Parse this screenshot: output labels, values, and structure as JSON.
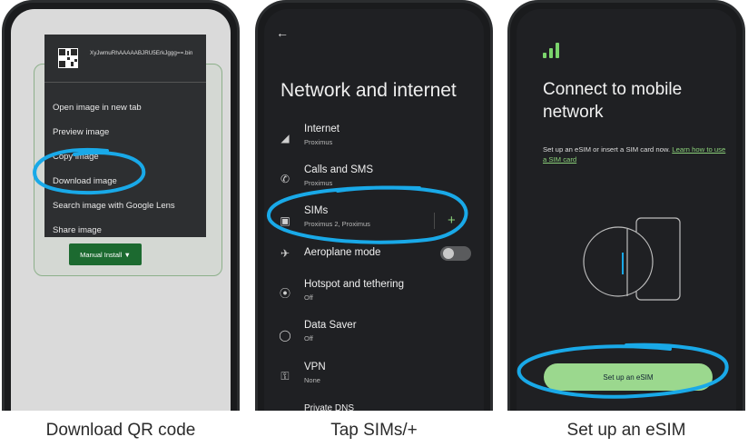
{
  "panels": [
    {
      "caption": "Download QR code",
      "file_name": "XyJwmuRhAAAAABJRU5ErkJggg==.bin",
      "menu_items": [
        "Open image in new tab",
        "Preview image",
        "Copy image",
        "Download image",
        "Search image with Google Lens",
        "Share image"
      ],
      "install_button": "Manual Install ▼"
    },
    {
      "caption": "Tap SIMs/+",
      "title": "Network and internet",
      "rows": [
        {
          "title": "Internet",
          "subtitle": "Proximus"
        },
        {
          "title": "Calls and SMS",
          "subtitle": "Proximus"
        },
        {
          "title": "SIMs",
          "subtitle": "Proximus 2, Proximus"
        },
        {
          "title": "Aeroplane mode",
          "subtitle": ""
        },
        {
          "title": "Hotspot and tethering",
          "subtitle": "Off"
        },
        {
          "title": "Data Saver",
          "subtitle": "Off"
        },
        {
          "title": "VPN",
          "subtitle": "None"
        },
        {
          "title": "Private DNS",
          "subtitle": ""
        }
      ],
      "add_label": "+",
      "aeroplane_mode_on": false
    },
    {
      "caption": "Set up an eSIM",
      "title": "Connect to mobile network",
      "body_text": "Set up an eSIM or insert a SIM card now.",
      "learn_link": "Learn how to use a SIM card",
      "button": "Set up an eSIM"
    }
  ],
  "colors": {
    "highlight_ring": "#19a9e8",
    "accent_green": "#8bd07a",
    "install_green": "#1c6a30"
  }
}
